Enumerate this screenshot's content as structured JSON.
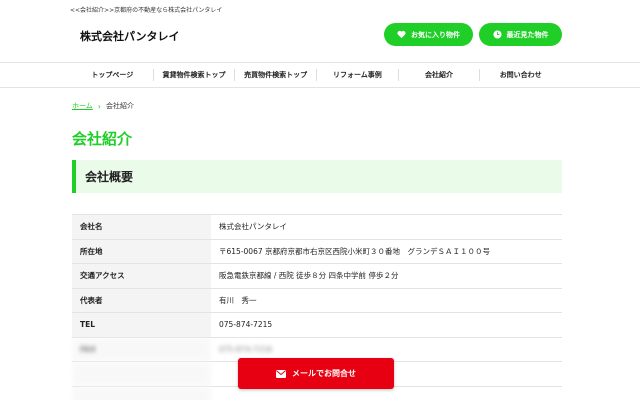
{
  "header": {
    "topnote": "<<会社紹介>>京都府の不動産なら株式会社パンタレイ",
    "logo": "株式会社パンタレイ",
    "fav_label": "お気に入り物件",
    "recent_label": "最近見た物件",
    "accent": "#1fcf28"
  },
  "nav": {
    "items": [
      "トップページ",
      "賃貸物件検索トップ",
      "売買物件検索トップ",
      "リフォーム事例",
      "会社紹介",
      "お問い合わせ"
    ]
  },
  "breadcrumb": {
    "home": "ホーム",
    "current": "会社紹介"
  },
  "page": {
    "title": "会社紹介",
    "section_title": "会社概要"
  },
  "table": {
    "rows": [
      {
        "label": "会社名",
        "value": "株式会社パンタレイ"
      },
      {
        "label": "所在地",
        "value": "〒615-0067 京都府京都市右京区西院小米町３０番地　グランデＳＡＩ１００号"
      },
      {
        "label": "交通アクセス",
        "value": "阪急電鉄京都線 / 西院 徒歩８分 四条中学前 停歩２分"
      },
      {
        "label": "代表者",
        "value": "有川　秀一"
      },
      {
        "label": "TEL",
        "value": "075-874-7215"
      },
      {
        "label": "FAX",
        "value": "075-874-7216"
      },
      {
        "label": "",
        "value": ""
      },
      {
        "label": "",
        "value": ""
      }
    ]
  },
  "footer_cta": {
    "mail_label": "メールでお問合せ",
    "color": "#e60012"
  }
}
